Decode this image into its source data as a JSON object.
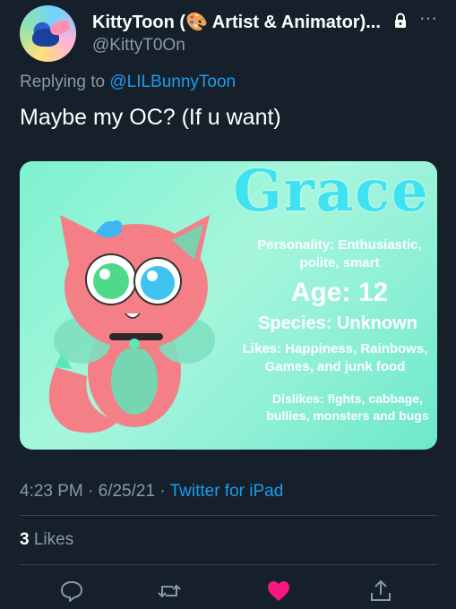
{
  "author": {
    "display_name": "KittyToon (🎨 Artist & Animator)...",
    "handle": "@KittyT0On",
    "avatar_icon": "avatar-image",
    "protected_icon": "lock-icon",
    "more_icon": "more-icon"
  },
  "reply_context": {
    "prefix": "Replying to ",
    "mention": "@LILBunnyToon"
  },
  "tweet": {
    "text": "Maybe my OC? (If u want)"
  },
  "media_card": {
    "name": "Grace",
    "personality": "Personality: Enthusiastic, polite, smart",
    "age": "Age: 12",
    "species": "Species: Unknown",
    "likes": "Likes: Happiness, Rainbows, Games, and junk food",
    "dislikes": "Dislikes: fights, cabbage, bullies, monsters and bugs"
  },
  "meta": {
    "time_date": "4:23 PM · 6/25/21 · ",
    "client": "Twitter for iPad"
  },
  "stats": {
    "likes_count": "3",
    "likes_label": " Likes"
  },
  "actions": [
    {
      "name": "reply-icon"
    },
    {
      "name": "retweet-icon"
    },
    {
      "name": "like-icon",
      "color": "#f91880"
    },
    {
      "name": "share-icon"
    }
  ],
  "colors": {
    "background": "#15202b",
    "link": "#1d9bf0",
    "secondary_text": "#8b98a5",
    "like": "#f91880"
  }
}
